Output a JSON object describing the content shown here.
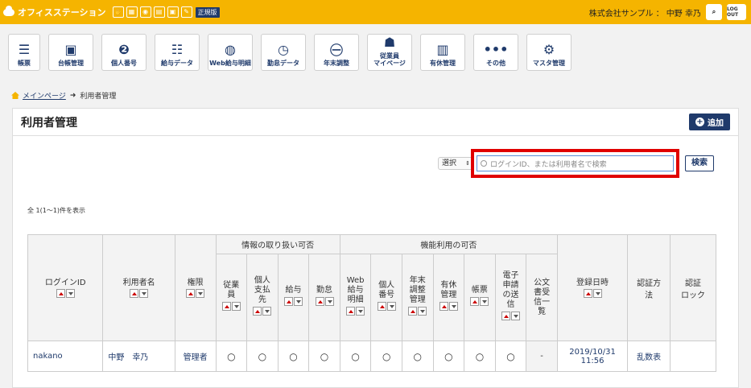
{
  "header": {
    "app_name": "オフィスステーション",
    "edition_badge": "正規版",
    "company": "株式会社サンプル ： 中野 幸乃",
    "logout_label": "LOG OUT"
  },
  "nav": [
    {
      "label": "帳票",
      "icon": "document-list-icon"
    },
    {
      "label": "台帳管理",
      "icon": "ledger-icon"
    },
    {
      "label": "個人番号",
      "icon": "personal-number-icon"
    },
    {
      "label": "給与データ",
      "icon": "salary-data-icon"
    },
    {
      "label": "Web給与明細",
      "icon": "web-payslip-icon"
    },
    {
      "label": "勤怠データ",
      "icon": "attendance-icon"
    },
    {
      "label": "年末調整",
      "icon": "year-end-adjustment-icon"
    },
    {
      "label": "従業員\nマイページ",
      "icon": "employee-mypage-icon"
    },
    {
      "label": "有休管理",
      "icon": "paid-leave-icon"
    },
    {
      "label": "その他",
      "icon": "more-icon"
    },
    {
      "label": "マスタ管理",
      "icon": "gear-icon"
    }
  ],
  "breadcrumb": {
    "home": "メインページ",
    "current": "利用者管理"
  },
  "panel": {
    "title": "利用者管理",
    "add_button": "追加",
    "select_label": "選択",
    "search_placeholder": "ログインID、または利用者名で検索",
    "search_button": "検索",
    "count_text": "全 1(1〜1)件を表示"
  },
  "table": {
    "headers": {
      "login_id": "ログインID",
      "user_name": "利用者名",
      "permission": "権限",
      "info_group": "情報の取り扱い可否",
      "func_group": "機能利用の可否",
      "registered": "登録日時",
      "auth_method": "認証方\n法",
      "auth_lock": "認証\nロック"
    },
    "info_cols": [
      "従業\n員",
      "個人\n支払\n先",
      "給与",
      "勤怠"
    ],
    "func_cols": [
      "Web\n給与\n明細",
      "個人\n番号",
      "年末\n調整\n管理",
      "有休\n管理",
      "帳票",
      "電子\n申請\nの送\n信",
      "公文\n書受\n信一\n覧"
    ],
    "rows": [
      {
        "login_id": "nakano",
        "user_name": "中野　幸乃",
        "permission": "管理者",
        "marks": [
          "○",
          "○",
          "○",
          "○",
          "○",
          "○",
          "○",
          "○",
          "○",
          "○",
          "-"
        ],
        "registered": "2019/10/31\n11:56",
        "auth_method": "乱数表",
        "auth_lock": ""
      }
    ]
  }
}
